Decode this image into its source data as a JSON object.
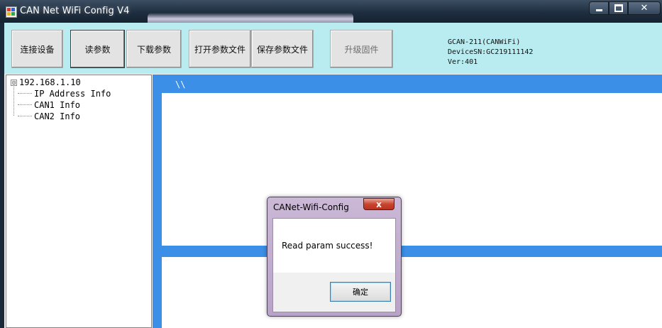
{
  "window": {
    "title": "CAN Net WiFi Config V4",
    "icon": "app-grid-icon",
    "controls": {
      "minimize_icon": "minimize-icon",
      "maximize_icon": "maximize-icon",
      "close_label": "✕"
    }
  },
  "toolbar": {
    "buttons": [
      {
        "id": "connect",
        "label": "连接设备"
      },
      {
        "id": "read",
        "label": "读参数"
      },
      {
        "id": "download",
        "label": "下载参数"
      },
      {
        "id": "open",
        "label": "打开参数文件"
      },
      {
        "id": "save",
        "label": "保存参数文件"
      },
      {
        "id": "upgrade",
        "label": "升级固件"
      }
    ],
    "device_info": {
      "model": "GCAN-211(CANWiFi)",
      "serial": "DeviceSN:GC219111142",
      "version": "Ver:401"
    },
    "colors": {
      "background": "#b9ecf0"
    }
  },
  "tree": {
    "expander": "⊟",
    "root": "192.168.1.10",
    "children": [
      "IP Address Info",
      "CAN1 Info",
      "CAN2 Info"
    ]
  },
  "content": {
    "path": "\\\\",
    "colors": {
      "frame": "#3b8fe6"
    }
  },
  "dialog": {
    "title": "CANet-Wifi-Config",
    "close_label": "x",
    "message": "Read param success!",
    "ok_label": "确定"
  }
}
